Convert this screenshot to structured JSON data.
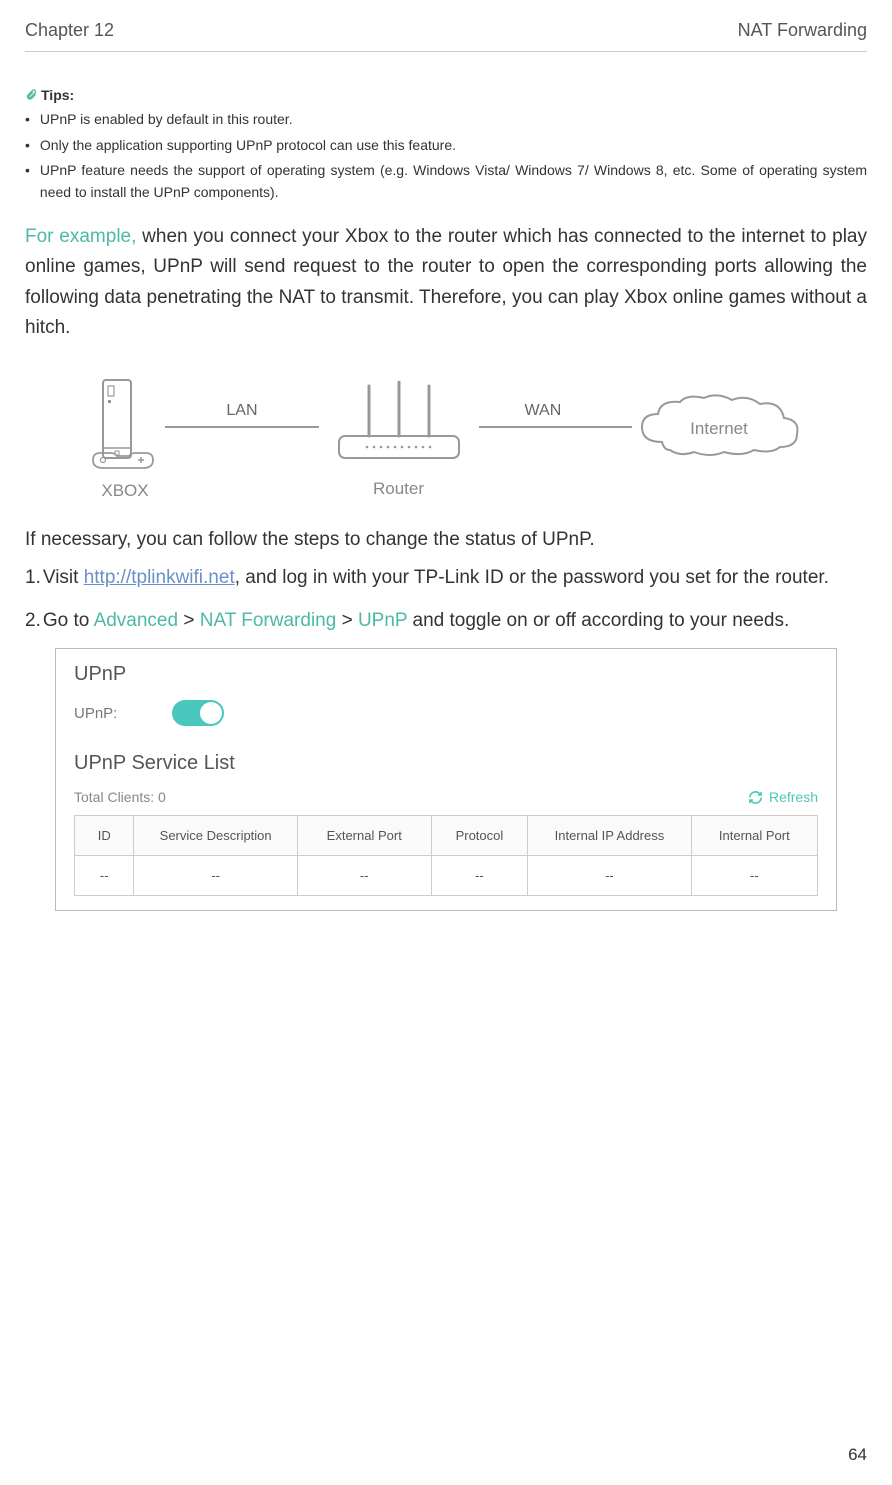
{
  "header": {
    "chapter": "Chapter 12",
    "title": "NAT Forwarding"
  },
  "tips": {
    "label": "Tips:",
    "items": [
      "UPnP is enabled by default in this router.",
      "Only the application supporting UPnP protocol can use this feature.",
      "UPnP feature needs the support of operating system (e.g. Windows Vista/ Windows 7/ Windows 8, etc. Some of operating system need to install the UPnP components)."
    ]
  },
  "example": {
    "lead": "For example,",
    "rest": " when you connect your Xbox to the router which has connected to the internet to play online games, UPnP will send request to the router to open the corresponding ports allowing the following data penetrating the NAT to transmit. Therefore, you can play Xbox online games without a hitch."
  },
  "diagram": {
    "xbox": "XBOX",
    "lan": "LAN",
    "router": "Router",
    "wan": "WAN",
    "internet": "Internet"
  },
  "steps": {
    "intro": "If necessary, you can follow the steps to change the status of UPnP.",
    "s1_num": "1.",
    "s1_pre": " Visit ",
    "s1_link": "http://tplinkwifi.net",
    "s1_post": ", and log in with your TP-Link ID or the password you set for the router.",
    "s2_num": "2.",
    "s2_pre": " Go to ",
    "s2_adv": "Advanced",
    "s2_gt1": " > ",
    "s2_nat": "NAT Forwarding",
    "s2_gt2": " > ",
    "s2_upnp": "UPnP",
    "s2_post": " and toggle on or off according to your needs."
  },
  "panel": {
    "title": "UPnP",
    "toggle_label": "UPnP:",
    "list_title": "UPnP Service List",
    "clients_label": "Total Clients:",
    "clients_count": "0",
    "refresh": "Refresh",
    "cols": {
      "id": "ID",
      "desc": "Service Description",
      "ext": "External Port",
      "proto": "Protocol",
      "ip": "Internal IP Address",
      "intp": "Internal Port"
    },
    "empty": "--"
  },
  "page_number": "64"
}
